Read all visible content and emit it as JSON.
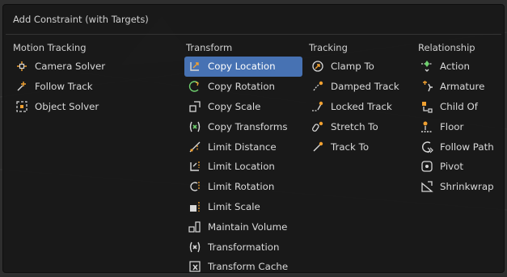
{
  "menu": {
    "title": "Add Constraint (with Targets)",
    "columns": [
      {
        "header": "Motion Tracking",
        "items": [
          {
            "label": "Camera Solver",
            "icon": "camera-solver-icon"
          },
          {
            "label": "Follow Track",
            "icon": "follow-track-icon"
          },
          {
            "label": "Object Solver",
            "icon": "object-solver-icon"
          }
        ]
      },
      {
        "header": "Transform",
        "items": [
          {
            "label": "Copy Location",
            "icon": "copy-location-icon",
            "active": true
          },
          {
            "label": "Copy Rotation",
            "icon": "copy-rotation-icon"
          },
          {
            "label": "Copy Scale",
            "icon": "copy-scale-icon"
          },
          {
            "label": "Copy Transforms",
            "icon": "copy-transforms-icon"
          },
          {
            "label": "Limit Distance",
            "icon": "limit-distance-icon"
          },
          {
            "label": "Limit Location",
            "icon": "limit-location-icon"
          },
          {
            "label": "Limit Rotation",
            "icon": "limit-rotation-icon"
          },
          {
            "label": "Limit Scale",
            "icon": "limit-scale-icon"
          },
          {
            "label": "Maintain Volume",
            "icon": "maintain-volume-icon"
          },
          {
            "label": "Transformation",
            "icon": "transformation-icon"
          },
          {
            "label": "Transform Cache",
            "icon": "transform-cache-icon"
          }
        ]
      },
      {
        "header": "Tracking",
        "items": [
          {
            "label": "Clamp To",
            "icon": "clamp-to-icon"
          },
          {
            "label": "Damped Track",
            "icon": "damped-track-icon"
          },
          {
            "label": "Locked Track",
            "icon": "locked-track-icon"
          },
          {
            "label": "Stretch To",
            "icon": "stretch-to-icon"
          },
          {
            "label": "Track To",
            "icon": "track-to-icon"
          }
        ]
      },
      {
        "header": "Relationship",
        "items": [
          {
            "label": "Action",
            "icon": "action-icon"
          },
          {
            "label": "Armature",
            "icon": "armature-icon"
          },
          {
            "label": "Child Of",
            "icon": "child-of-icon"
          },
          {
            "label": "Floor",
            "icon": "floor-icon"
          },
          {
            "label": "Follow Path",
            "icon": "follow-path-icon"
          },
          {
            "label": "Pivot",
            "icon": "pivot-icon"
          },
          {
            "label": "Shrinkwrap",
            "icon": "shrinkwrap-icon"
          }
        ]
      }
    ]
  },
  "colors": {
    "highlight": "#4772b3",
    "icon_accent": "#f0a030",
    "icon_green": "#6fd06f",
    "icon_light": "#d8d8d8",
    "menu_bg": "#181818",
    "text": "#d8d8d8"
  }
}
